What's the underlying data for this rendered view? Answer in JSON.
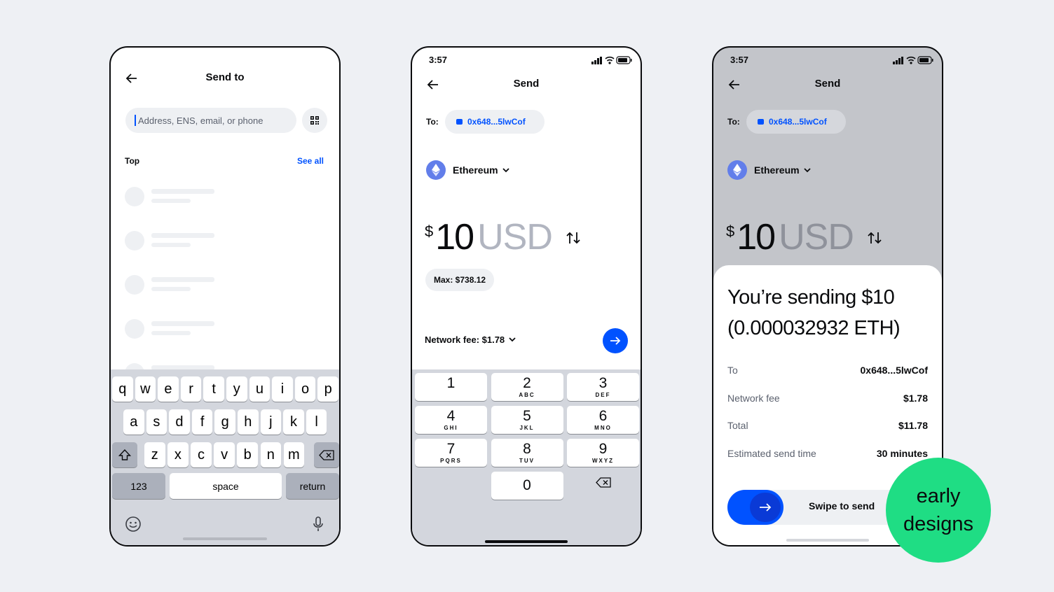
{
  "screen1": {
    "title": "Send to",
    "search_placeholder": "Address, ENS, email, or phone",
    "section_label": "Top",
    "see_all": "See all",
    "keyboard": {
      "row1": [
        "q",
        "w",
        "e",
        "r",
        "t",
        "y",
        "u",
        "i",
        "o",
        "p"
      ],
      "row2": [
        "a",
        "s",
        "d",
        "f",
        "g",
        "h",
        "j",
        "k",
        "l"
      ],
      "row3": [
        "z",
        "x",
        "c",
        "v",
        "b",
        "n",
        "m"
      ],
      "numbers_key": "123",
      "space_key": "space",
      "return_key": "return"
    }
  },
  "screen2": {
    "time": "3:57",
    "title": "Send",
    "to_label": "To:",
    "address": "0x648...5lwCof",
    "asset": "Ethereum",
    "amount_symbol": "$",
    "amount_value": "10",
    "amount_currency": "USD",
    "max": "Max: $738.12",
    "network_fee": "Network fee: $1.78",
    "numpad": [
      {
        "digit": "1",
        "letters": ""
      },
      {
        "digit": "2",
        "letters": "ABC"
      },
      {
        "digit": "3",
        "letters": "DEF"
      },
      {
        "digit": "4",
        "letters": "GHI"
      },
      {
        "digit": "5",
        "letters": "JKL"
      },
      {
        "digit": "6",
        "letters": "MNO"
      },
      {
        "digit": "7",
        "letters": "PQRS"
      },
      {
        "digit": "8",
        "letters": "TUV"
      },
      {
        "digit": "9",
        "letters": "WXYZ"
      },
      {
        "digit": "0",
        "letters": ""
      }
    ]
  },
  "screen3": {
    "time": "3:57",
    "title": "Send",
    "to_label": "To:",
    "address": "0x648...5lwCof",
    "asset": "Ethereum",
    "amount_symbol": "$",
    "amount_value": "10",
    "amount_currency": "USD",
    "sheet_title": "You’re sending $10 (0.000032932 ETH)",
    "details": [
      {
        "label": "To",
        "value": "0x648...5lwCof"
      },
      {
        "label": "Network fee",
        "value": "$1.78"
      },
      {
        "label": "Total",
        "value": "$11.78"
      },
      {
        "label": "Estimated send time",
        "value": "30 minutes"
      }
    ],
    "swipe_label": "Swipe to send"
  },
  "badge": {
    "line1": "early",
    "line2": "designs"
  },
  "colors": {
    "accent": "#0052ff",
    "badge": "#1fdd84",
    "ethereum": "#627eea"
  }
}
